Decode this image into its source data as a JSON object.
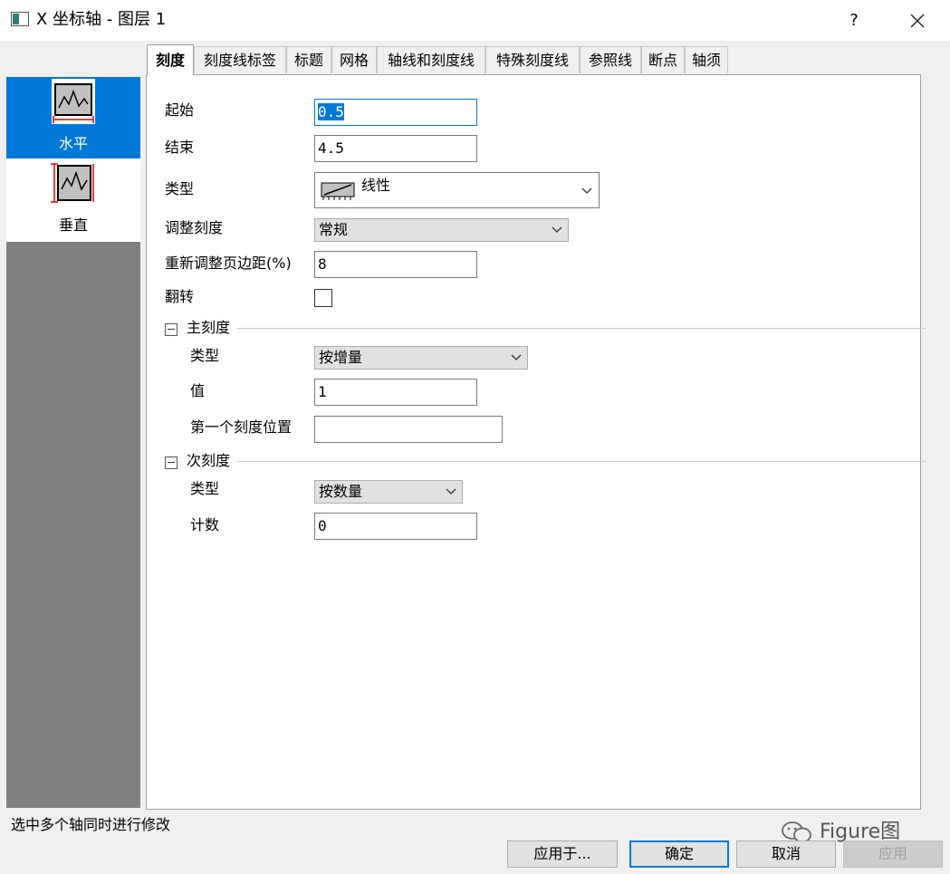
{
  "window": {
    "title": "X 坐标轴 - 图层 1",
    "help_label": "?"
  },
  "tabs": [
    {
      "label": "刻度",
      "active": true
    },
    {
      "label": "刻度线标签"
    },
    {
      "label": "标题"
    },
    {
      "label": "网格"
    },
    {
      "label": "轴线和刻度线"
    },
    {
      "label": "特殊刻度线"
    },
    {
      "label": "参照线"
    },
    {
      "label": "断点"
    },
    {
      "label": "轴须"
    }
  ],
  "axes": [
    {
      "label": "水平",
      "selected": true,
      "icon": "horizontal-axis-icon"
    },
    {
      "label": "垂直",
      "selected": false,
      "icon": "vertical-axis-icon"
    }
  ],
  "scale": {
    "from_label": "起始",
    "from_value": "0.5",
    "to_label": "结束",
    "to_value": "4.5",
    "type_label": "类型",
    "type_value": "线性",
    "rescale_label": "调整刻度",
    "rescale_value": "常规",
    "margin_label": "重新调整页边距(%)",
    "margin_value": "8",
    "reverse_label": "翻转",
    "reverse_checked": false
  },
  "major_ticks": {
    "section_label": "主刻度",
    "type_label": "类型",
    "type_value": "按增量",
    "value_label": "值",
    "value": "1",
    "anchor_label": "第一个刻度位置",
    "anchor_value": ""
  },
  "minor_ticks": {
    "section_label": "次刻度",
    "type_label": "类型",
    "type_value": "按数量",
    "count_label": "计数",
    "count_value": "0"
  },
  "status": "选中多个轴同时进行修改",
  "buttons": {
    "apply_to": "应用于...",
    "ok": "确定",
    "cancel": "取消",
    "apply": "应用"
  },
  "watermark": "Figure图",
  "colors": {
    "accent": "#0078d7",
    "panel_gray": "#808080",
    "dialog_bg": "#f0f0f0"
  }
}
